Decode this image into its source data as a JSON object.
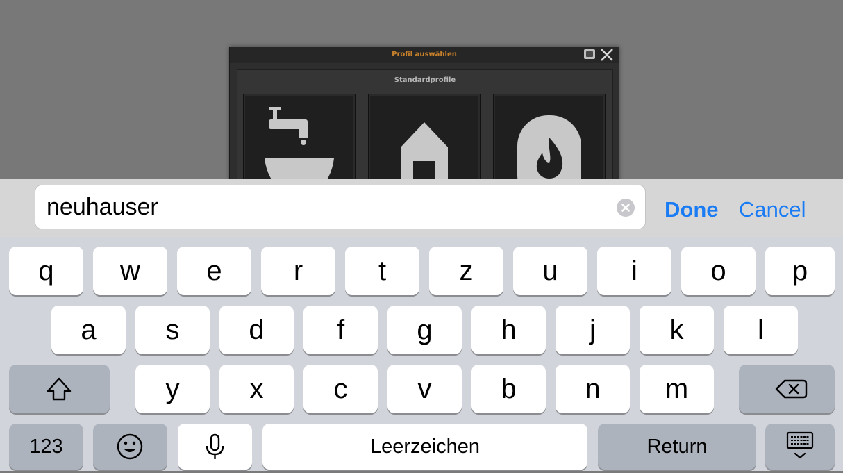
{
  "dialog": {
    "title": "Profil auswählen",
    "section_title": "Standardprofile",
    "tiles": [
      {
        "icon": "faucet-basin-icon"
      },
      {
        "icon": "house-icon"
      },
      {
        "icon": "flame-icon"
      }
    ]
  },
  "search": {
    "value": "neuhauser",
    "done_label": "Done",
    "cancel_label": "Cancel"
  },
  "keyboard": {
    "row1": [
      "q",
      "w",
      "e",
      "r",
      "t",
      "z",
      "u",
      "i",
      "o",
      "p"
    ],
    "row2": [
      "a",
      "s",
      "d",
      "f",
      "g",
      "h",
      "j",
      "k",
      "l"
    ],
    "row3": [
      "y",
      "x",
      "c",
      "v",
      "b",
      "n",
      "m"
    ],
    "numbers_label": "123",
    "space_label": "Leerzeichen",
    "return_label": "Return"
  },
  "colors": {
    "accent": "#1a7cf5",
    "dialog_title": "#c8812a",
    "keyboard_bg": "#d1d4da",
    "dark_key": "#acb3bd"
  }
}
